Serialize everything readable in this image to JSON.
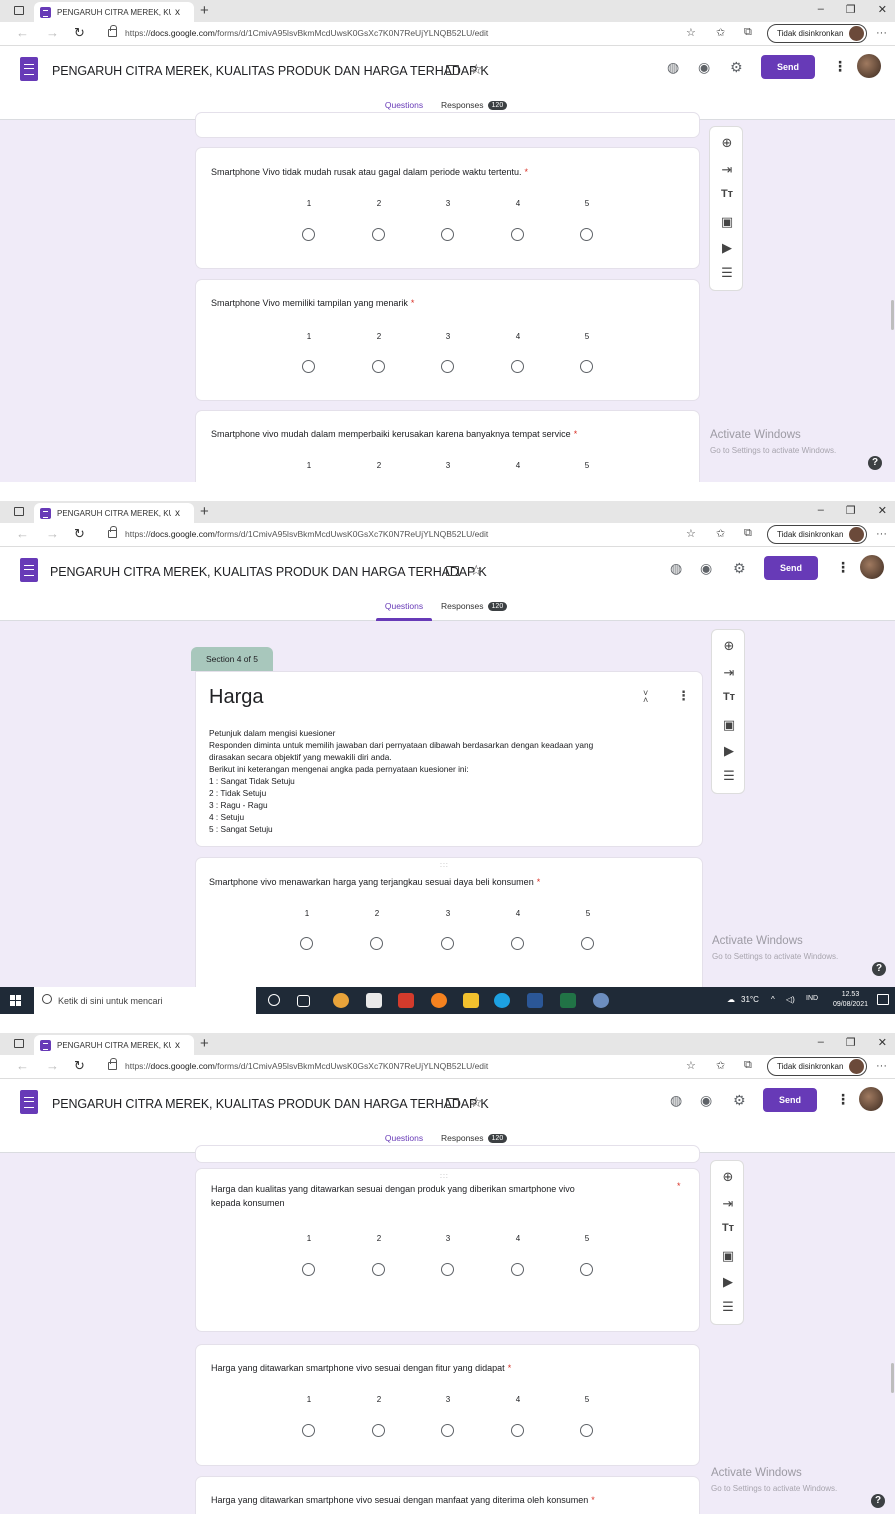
{
  "browser": {
    "tab_title": "PENGARUH CITRA MEREK, KUAL",
    "tab_close": "x",
    "new_tab": "+",
    "window_controls": [
      "–",
      "❐",
      "✕"
    ],
    "url_prefix": "https://",
    "url_host": "docs.google.com",
    "url_path": "/forms/d/1CmivA95lsvBkmMcdUwsK0GsXc7K0N7ReUjYLNQB52LU/edit",
    "sync_label": "Tidak disinkronkan"
  },
  "form": {
    "title": "PENGARUH CITRA MEREK, KUALITAS PRODUK DAN HARGA TERHADAP K",
    "send_label": "Send",
    "tabs": {
      "questions": "Questions",
      "responses": "Responses",
      "responses_count": "120"
    }
  },
  "scale": [
    "1",
    "2",
    "3",
    "4",
    "5"
  ],
  "screen1": {
    "q1": "Smartphone Vivo tidak mudah rusak atau gagal dalam periode waktu tertentu.",
    "q2": "Smartphone Vivo memiliki tampilan yang menarik",
    "q3": "Smartphone vivo mudah dalam memperbaiki kerusakan karena banyaknya tempat service"
  },
  "screen2": {
    "section_badge": "Section 4 of 5",
    "section_title": "Harga",
    "description": [
      "Petunjuk dalam mengisi kuesioner",
      "Responden diminta untuk memilih jawaban dari pernyataan dibawah berdasarkan dengan keadaan yang",
      "dirasakan secara objektif yang mewakili diri anda.",
      "Berikut ini keterangan mengenai angka pada pernyataan kuesioner ini:",
      "1 : Sangat Tidak Setuju",
      "2 : Tidak Setuju",
      "3 : Ragu - Ragu",
      "4 : Setuju",
      "5 : Sangat Setuju"
    ],
    "q1": "Smartphone vivo menawarkan harga yang terjangkau sesuai daya beli konsumen"
  },
  "screen3": {
    "q1_line1": "Harga dan kualitas yang ditawarkan sesuai dengan produk yang diberikan smartphone vivo",
    "q1_line2": "kepada konsumen",
    "q2": "Harga yang ditawarkan smartphone vivo sesuai dengan fitur yang didapat",
    "q3": "Harga yang ditawarkan smartphone vivo sesuai dengan manfaat yang diterima oleh konsumen"
  },
  "watermark": {
    "title": "Activate Windows",
    "subtitle": "Go to Settings to activate Windows."
  },
  "taskbar": {
    "search_placeholder": "Ketik di sini untuk mencari",
    "weather": "31°C",
    "language": "IND",
    "time": "12.53",
    "date": "09/08/2021"
  },
  "required_mark": "*",
  "drag_handle": ":::",
  "help": "?"
}
